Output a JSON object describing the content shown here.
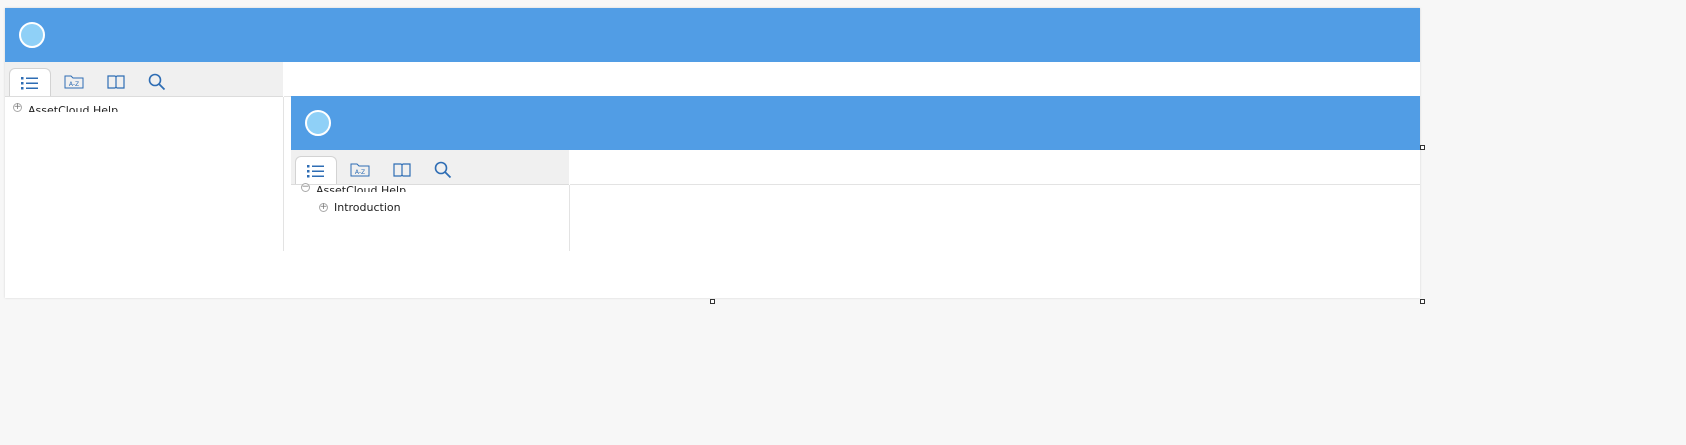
{
  "window": {
    "header_color": "#519de5",
    "logo_icon": "circle-logo-icon"
  },
  "tabs": [
    {
      "id": "contents",
      "icon": "list-icon",
      "active": true
    },
    {
      "id": "index",
      "icon": "az-index-icon",
      "active": false
    },
    {
      "id": "glossary",
      "icon": "open-book-icon",
      "active": false
    },
    {
      "id": "search",
      "icon": "search-icon",
      "active": false
    }
  ],
  "outer_tree": {
    "root_label": "AssetCloud Help",
    "root_expander": "+"
  },
  "inner_tree": {
    "root_label": "AssetCloud Help",
    "root_expander": "−",
    "children": [
      {
        "label": "Introduction",
        "expander": "+"
      }
    ]
  }
}
